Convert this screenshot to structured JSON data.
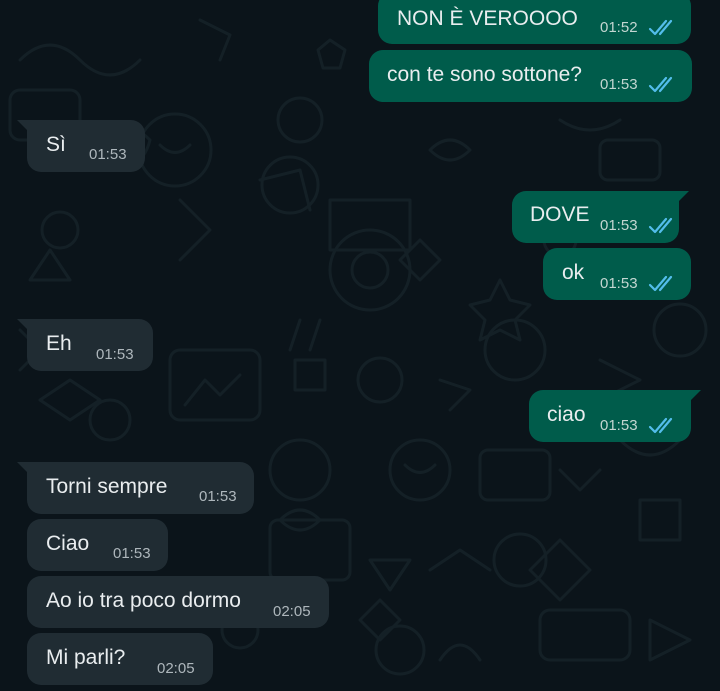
{
  "chat": {
    "messages": [
      {
        "text": "NON È VEROOOO",
        "time": "01:52",
        "direction": "outgoing",
        "status": "read"
      },
      {
        "text": "con te sono sottone?",
        "time": "01:53",
        "direction": "outgoing",
        "status": "read"
      },
      {
        "text": "Sì",
        "time": "01:53",
        "direction": "incoming"
      },
      {
        "text": "DOVE",
        "time": "01:53",
        "direction": "outgoing",
        "status": "read"
      },
      {
        "text": "ok",
        "time": "01:53",
        "direction": "outgoing",
        "status": "read"
      },
      {
        "text": "Eh",
        "time": "01:53",
        "direction": "incoming"
      },
      {
        "text": "ciao",
        "time": "01:53",
        "direction": "outgoing",
        "status": "read"
      },
      {
        "text": "Torni sempre",
        "time": "01:53",
        "direction": "incoming"
      },
      {
        "text": "Ciao",
        "time": "01:53",
        "direction": "incoming"
      },
      {
        "text": "Ao io tra poco dormo",
        "time": "02:05",
        "direction": "incoming"
      },
      {
        "text": "Mi parli?",
        "time": "02:05",
        "direction": "incoming"
      }
    ]
  },
  "colors": {
    "background": "#0b141a",
    "incoming_bubble": "#202c33",
    "outgoing_bubble": "#005c4b",
    "read_ticks": "#53bdeb",
    "text": "#e9edef"
  },
  "icons": {
    "read_receipt": "double-check-icon",
    "wallpaper": "doodle-pattern"
  }
}
